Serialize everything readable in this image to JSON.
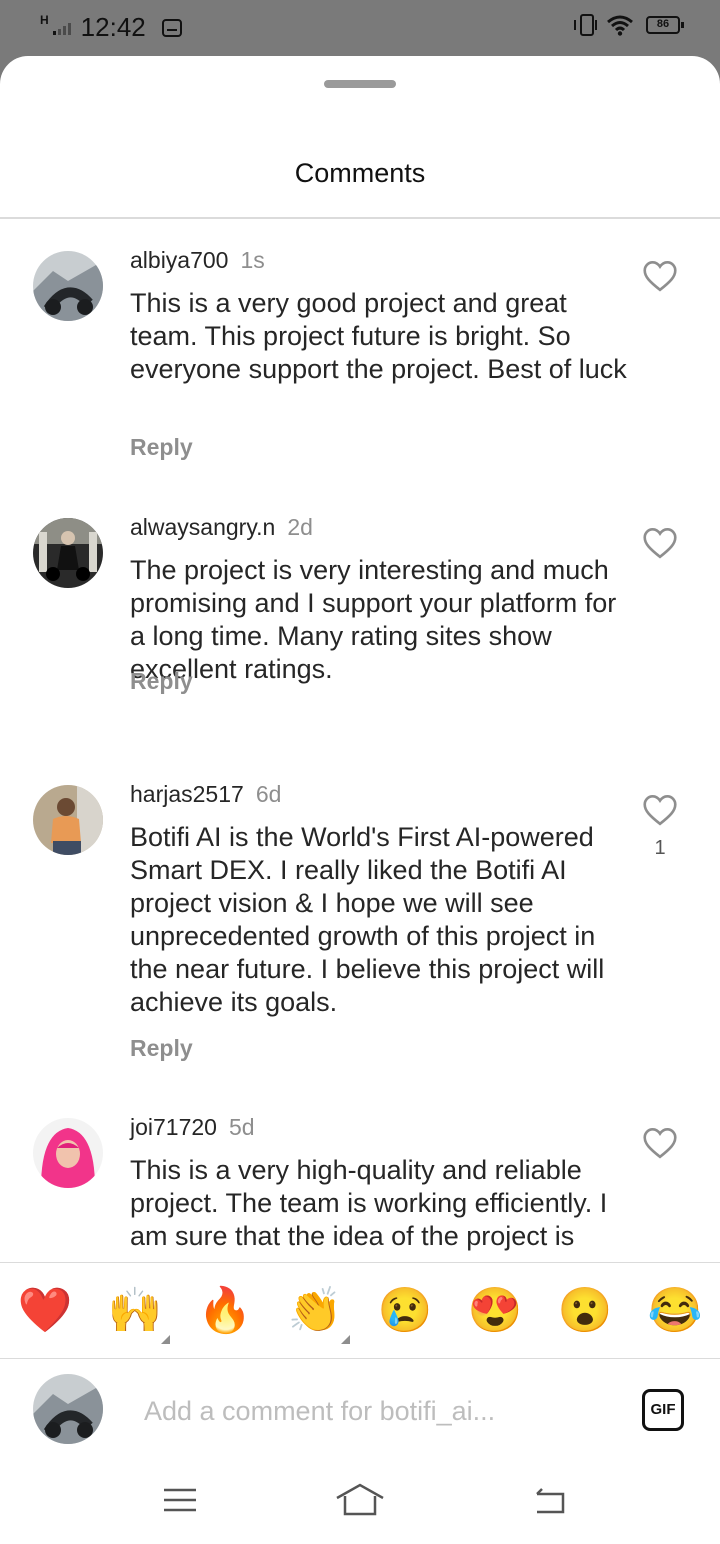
{
  "status_bar": {
    "network": "H",
    "time": "12:42",
    "battery": "86"
  },
  "sheet": {
    "title": "Comments"
  },
  "comments": [
    {
      "username": "albiya700",
      "time": "1s",
      "text": "This is a very good project and great team. This project future is bright. So everyone support the project. Best of luck",
      "reply_label": "Reply",
      "likes": ""
    },
    {
      "username": "alwaysangry.n",
      "time": "2d",
      "text": "The project is very interesting and much promising and I support your platform for a long time. Many rating sites show excellent ratings.",
      "reply_label": "Reply",
      "likes": ""
    },
    {
      "username": "harjas2517",
      "time": "6d",
      "text": "Botifi AI is the World's First AI-powered Smart DEX. I really liked the Botifi AI project vision & I hope we will see unprecedented growth of this project in the near future. I believe this project will achieve its goals.",
      "reply_label": "Reply",
      "likes": "1"
    },
    {
      "username": "joi71720",
      "time": "5d",
      "text": "This is a very high-quality and reliable project. The team is working efficiently. I am sure that the idea of the project is",
      "reply_label": "",
      "likes": ""
    }
  ],
  "emoji_bar": [
    "❤️",
    "🙌",
    "🔥",
    "👏",
    "😢",
    "😍",
    "😮",
    "😂"
  ],
  "composer": {
    "placeholder": "Add a comment for botifi_ai...",
    "gif_label": "GIF"
  },
  "colors": {
    "status_bar_bg": "#7a7a7a",
    "primary_text": "#262626",
    "secondary_text": "#8e8e8e",
    "divider": "#dbdbdb"
  }
}
